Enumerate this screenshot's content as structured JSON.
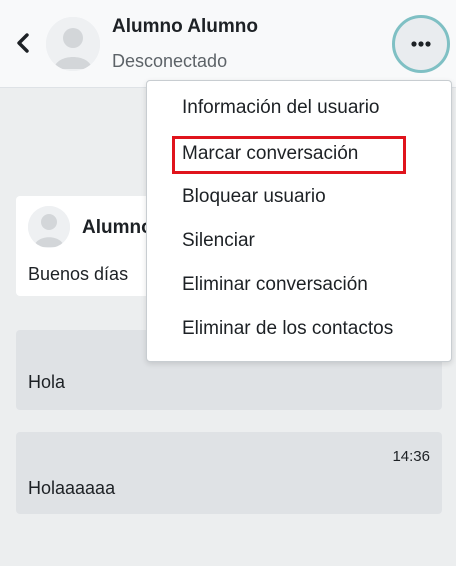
{
  "header": {
    "back_icon": "chevron-left-icon",
    "contact_name": "Alumno Alumno",
    "status": "Desconectado",
    "more_icon": "ellipsis-icon"
  },
  "menu": {
    "items": [
      {
        "label": "Información del usuario"
      },
      {
        "label": "Marcar conversación"
      },
      {
        "label": "Bloquear usuario"
      },
      {
        "label": "Silenciar"
      },
      {
        "label": "Eliminar conversación"
      },
      {
        "label": "Eliminar de los contactos"
      }
    ],
    "highlight_color": "#e0141c"
  },
  "messages": [
    {
      "sender": "Alumno",
      "text": "Buenos días"
    },
    {
      "text": "Hola"
    },
    {
      "time": "14:36",
      "text": "Holaaaaaa"
    }
  ],
  "colors": {
    "focus_ring": "#7fc0c4",
    "sent_bubble": "#dfe2e5",
    "background": "#eceeef"
  }
}
